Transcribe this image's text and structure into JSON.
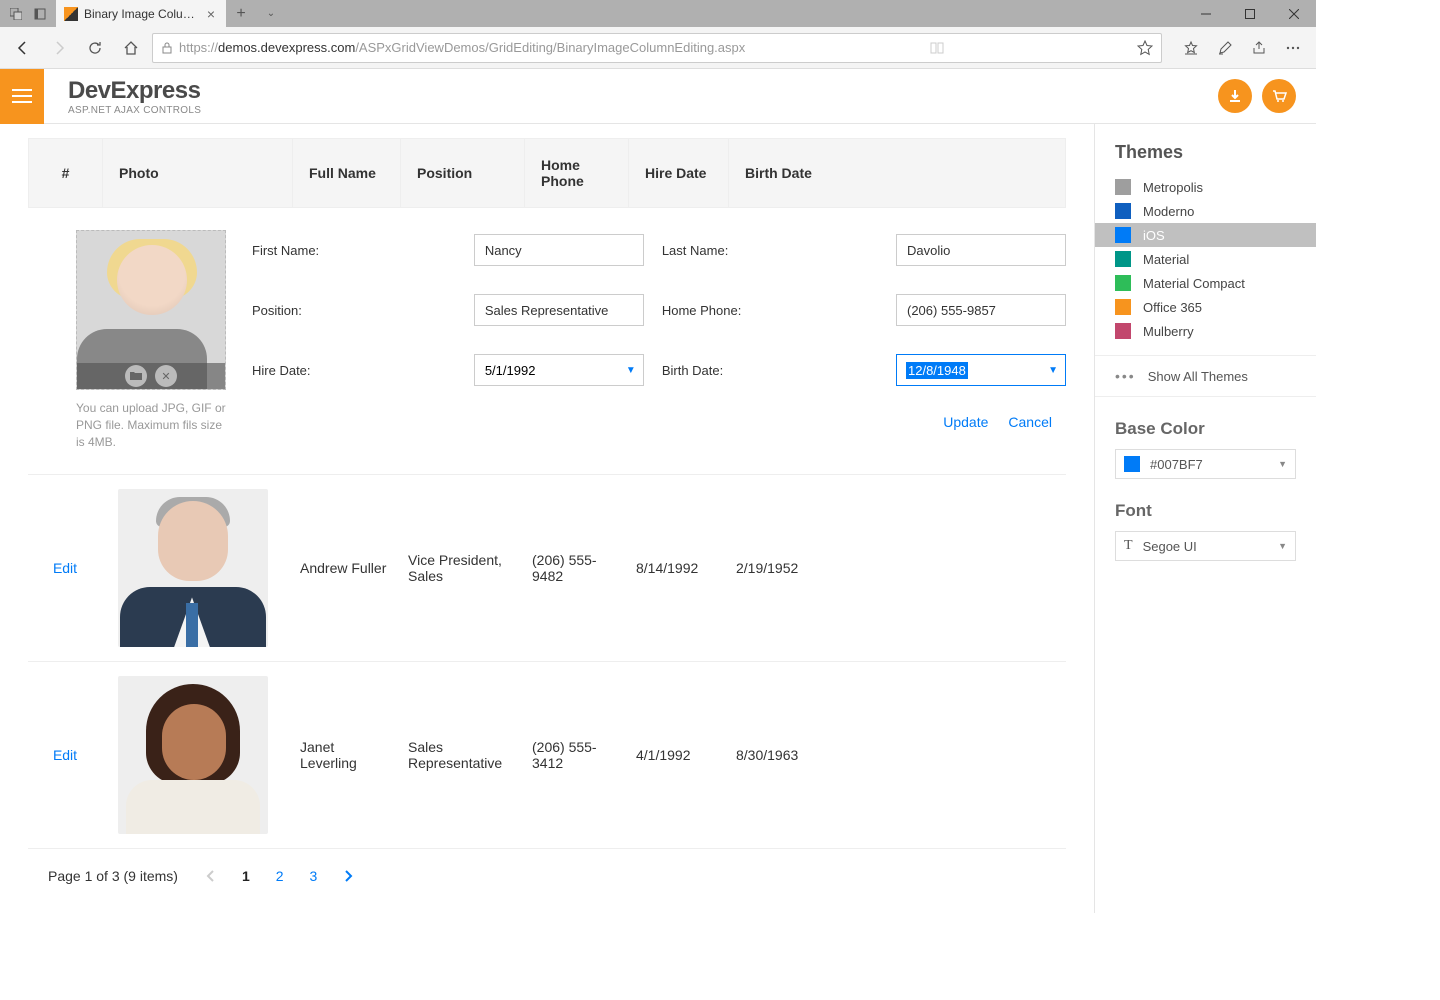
{
  "browser": {
    "tab_title": "Binary Image Column E",
    "url_prefix": "https://",
    "url_host": "demos.devexpress.com",
    "url_path": "/ASPxGridViewDemos/GridEditing/BinaryImageColumnEditing.aspx"
  },
  "header": {
    "brand": "DevExpress",
    "subtitle": "ASP.NET AJAX CONTROLS"
  },
  "grid": {
    "columns": {
      "num": "#",
      "photo": "Photo",
      "name": "Full Name",
      "position": "Position",
      "phone": "Home Phone",
      "hire": "Hire Date",
      "birth": "Birth Date"
    },
    "edit_link": "Edit",
    "edit_form": {
      "labels": {
        "first_name": "First Name:",
        "last_name": "Last Name:",
        "position": "Position:",
        "home_phone": "Home Phone:",
        "hire_date": "Hire Date:",
        "birth_date": "Birth Date:"
      },
      "values": {
        "first_name": "Nancy",
        "last_name": "Davolio",
        "position": "Sales Representative",
        "home_phone": "(206) 555-9857",
        "hire_date": "5/1/1992",
        "birth_date": "12/8/1948"
      },
      "upload_hint": "You can upload JPG, GIF or PNG file. Maximum fils size is 4MB.",
      "update": "Update",
      "cancel": "Cancel"
    },
    "rows": [
      {
        "name": "Andrew Fuller",
        "position": "Vice President, Sales",
        "phone": "(206) 555-9482",
        "hire": "8/14/1992",
        "birth": "2/19/1952"
      },
      {
        "name": "Janet Leverling",
        "position": "Sales Representative",
        "phone": "(206) 555-3412",
        "hire": "4/1/1992",
        "birth": "8/30/1963"
      }
    ],
    "pager": {
      "summary": "Page 1 of 3 (9 items)",
      "pages": [
        "1",
        "2",
        "3"
      ]
    }
  },
  "sidebar": {
    "themes_title": "Themes",
    "themes": [
      {
        "label": "Metropolis",
        "color": "#9e9e9e"
      },
      {
        "label": "Moderno",
        "color": "#0f5fbf"
      },
      {
        "label": "iOS",
        "color": "#007bf7",
        "selected": true
      },
      {
        "label": "Material",
        "color": "#009688"
      },
      {
        "label": "Material Compact",
        "color": "#2ebd59"
      },
      {
        "label": "Office 365",
        "color": "#f7941e"
      },
      {
        "label": "Mulberry",
        "color": "#c2476d"
      }
    ],
    "show_all": "Show All Themes",
    "base_color_title": "Base Color",
    "base_color_value": "#007BF7",
    "font_title": "Font",
    "font_value": "Segoe UI"
  }
}
